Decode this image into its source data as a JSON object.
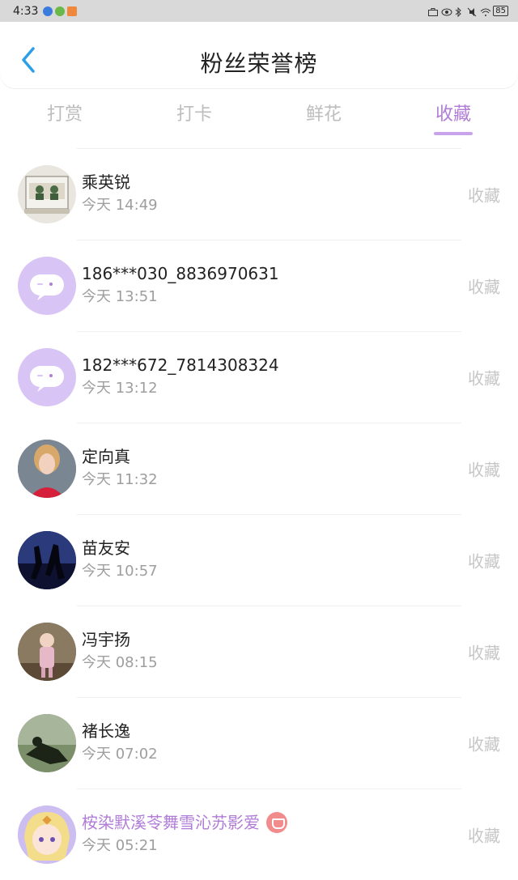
{
  "status_bar": {
    "time": "4:33",
    "battery": "85"
  },
  "header": {
    "title": "粉丝荣誉榜"
  },
  "tabs": [
    {
      "label": "打赏"
    },
    {
      "label": "打卡"
    },
    {
      "label": "鲜花"
    },
    {
      "label": "收藏"
    }
  ],
  "active_tab": "收藏",
  "colors": {
    "accent": "#b07cd6",
    "back": "#2f9ee9",
    "bubble": "#d9c5f5"
  },
  "rows": [
    {
      "name": "乘英锐",
      "time": "今天 14:49",
      "action": "收藏"
    },
    {
      "name": "186***030_8836970631",
      "time": "今天 13:51",
      "action": "收藏"
    },
    {
      "name": "182***672_7814308324",
      "time": "今天 13:12",
      "action": "收藏"
    },
    {
      "name": "定向真",
      "time": "今天 11:32",
      "action": "收藏"
    },
    {
      "name": "苗友安",
      "time": "今天 10:57",
      "action": "收藏"
    },
    {
      "name": "冯宇扬",
      "time": "今天 08:15",
      "action": "收藏"
    },
    {
      "name": "褚长逸",
      "time": "今天 07:02",
      "action": "收藏"
    },
    {
      "name": "桉染默溪苓舞雪沁苏影爱",
      "time": "今天 05:21",
      "action": "收藏"
    }
  ]
}
